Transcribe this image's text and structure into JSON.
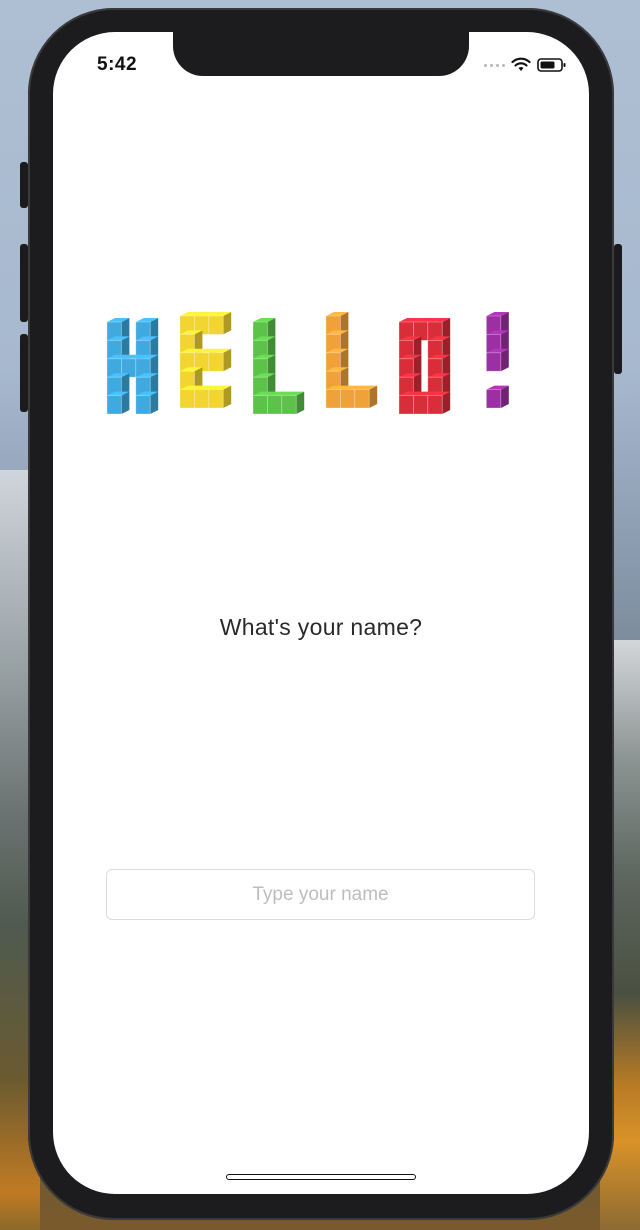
{
  "status_bar": {
    "time": "5:42",
    "icons": [
      "cellular-signal-icon",
      "wifi-icon",
      "battery-icon"
    ]
  },
  "logo": {
    "text": "HELLO!",
    "letter_colors": [
      "#3fa9e0",
      "#f2d531",
      "#5cc24a",
      "#f0a13a",
      "#d92d3a",
      "#9b2fa3"
    ]
  },
  "prompt": {
    "question": "What's your name?"
  },
  "name_input": {
    "value": "",
    "placeholder": "Type your name"
  }
}
